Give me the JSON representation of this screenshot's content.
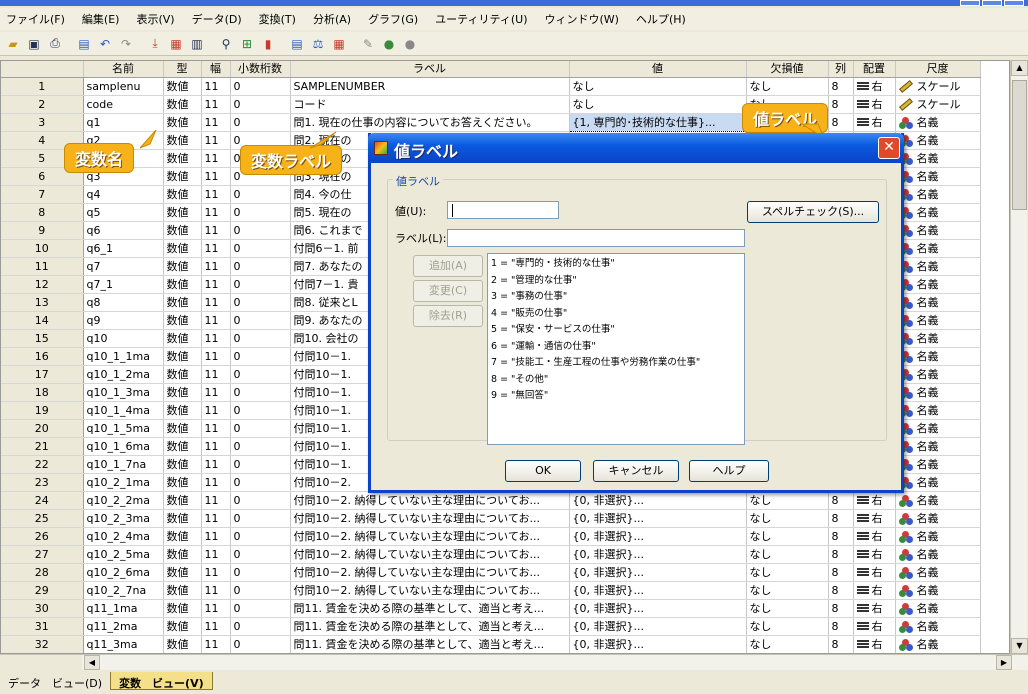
{
  "menubar": [
    "ファイル(F)",
    "編集(E)",
    "表示(V)",
    "データ(D)",
    "変換(T)",
    "分析(A)",
    "グラフ(G)",
    "ユーティリティ(U)",
    "ウィンドウ(W)",
    "ヘルプ(H)"
  ],
  "columns": [
    "",
    "名前",
    "型",
    "幅",
    "小数桁数",
    "ラベル",
    "値",
    "欠損値",
    "列",
    "配置",
    "尺度"
  ],
  "rows": [
    {
      "n": "1",
      "name": "samplenu",
      "type": "数値",
      "width": "11",
      "dec": "0",
      "label": "SAMPLENUMBER",
      "values": "なし",
      "missing": "なし",
      "cols": "8",
      "align": "右",
      "measure": "スケール"
    },
    {
      "n": "2",
      "name": "code",
      "type": "数値",
      "width": "11",
      "dec": "0",
      "label": "コード",
      "values": "なし",
      "missing": "なし",
      "cols": "8",
      "align": "右",
      "measure": "スケール"
    },
    {
      "n": "3",
      "name": "q1",
      "type": "数値",
      "width": "11",
      "dec": "0",
      "label": "問1. 現在の仕事の内容についてお答えください。",
      "values": "{1, 専門的･技術的な仕事}...",
      "missing": "なし",
      "cols": "8",
      "align": "右",
      "measure": "名義"
    },
    {
      "n": "4",
      "name": "q2",
      "type": "数値",
      "width": "11",
      "dec": "0",
      "label": "問2. 現在の",
      "values": "",
      "missing": "",
      "cols": "",
      "align": "",
      "measure": "名義"
    },
    {
      "n": "5",
      "name": "q3",
      "type": "数値",
      "width": "11",
      "dec": "0",
      "label": "問3. 現在の",
      "values": "",
      "missing": "",
      "cols": "",
      "align": "",
      "measure": "名義"
    },
    {
      "n": "6",
      "name": "q3",
      "type": "数値",
      "width": "11",
      "dec": "0",
      "label": "問3. 現在の",
      "values": "",
      "missing": "",
      "cols": "",
      "align": "",
      "measure": "名義"
    },
    {
      "n": "7",
      "name": "q4",
      "type": "数値",
      "width": "11",
      "dec": "0",
      "label": "問4. 今の仕",
      "values": "",
      "missing": "",
      "cols": "",
      "align": "",
      "measure": "名義"
    },
    {
      "n": "8",
      "name": "q5",
      "type": "数値",
      "width": "11",
      "dec": "0",
      "label": "問5. 現在の",
      "values": "",
      "missing": "",
      "cols": "",
      "align": "",
      "measure": "名義"
    },
    {
      "n": "9",
      "name": "q6",
      "type": "数値",
      "width": "11",
      "dec": "0",
      "label": "問6. これまで",
      "values": "",
      "missing": "",
      "cols": "",
      "align": "",
      "measure": "名義"
    },
    {
      "n": "10",
      "name": "q6_1",
      "type": "数値",
      "width": "11",
      "dec": "0",
      "label": "付問6－1. 前",
      "values": "",
      "missing": "",
      "cols": "",
      "align": "",
      "measure": "名義"
    },
    {
      "n": "11",
      "name": "q7",
      "type": "数値",
      "width": "11",
      "dec": "0",
      "label": "問7. あなたの",
      "values": "",
      "missing": "",
      "cols": "",
      "align": "",
      "measure": "名義"
    },
    {
      "n": "12",
      "name": "q7_1",
      "type": "数値",
      "width": "11",
      "dec": "0",
      "label": "付問7－1. 貴",
      "values": "",
      "missing": "",
      "cols": "",
      "align": "",
      "measure": "名義"
    },
    {
      "n": "13",
      "name": "q8",
      "type": "数値",
      "width": "11",
      "dec": "0",
      "label": "問8. 従来とL",
      "values": "",
      "missing": "",
      "cols": "",
      "align": "",
      "measure": "名義"
    },
    {
      "n": "14",
      "name": "q9",
      "type": "数値",
      "width": "11",
      "dec": "0",
      "label": "問9. あなたの",
      "values": "",
      "missing": "",
      "cols": "",
      "align": "",
      "measure": "名義"
    },
    {
      "n": "15",
      "name": "q10",
      "type": "数値",
      "width": "11",
      "dec": "0",
      "label": "問10. 会社の",
      "values": "",
      "missing": "",
      "cols": "",
      "align": "",
      "measure": "名義"
    },
    {
      "n": "16",
      "name": "q10_1_1ma",
      "type": "数値",
      "width": "11",
      "dec": "0",
      "label": "付問10－1.",
      "values": "",
      "missing": "",
      "cols": "",
      "align": "",
      "measure": "名義"
    },
    {
      "n": "17",
      "name": "q10_1_2ma",
      "type": "数値",
      "width": "11",
      "dec": "0",
      "label": "付問10－1.",
      "values": "",
      "missing": "",
      "cols": "",
      "align": "",
      "measure": "名義"
    },
    {
      "n": "18",
      "name": "q10_1_3ma",
      "type": "数値",
      "width": "11",
      "dec": "0",
      "label": "付問10－1.",
      "values": "",
      "missing": "",
      "cols": "",
      "align": "",
      "measure": "名義"
    },
    {
      "n": "19",
      "name": "q10_1_4ma",
      "type": "数値",
      "width": "11",
      "dec": "0",
      "label": "付問10－1.",
      "values": "",
      "missing": "",
      "cols": "",
      "align": "",
      "measure": "名義"
    },
    {
      "n": "20",
      "name": "q10_1_5ma",
      "type": "数値",
      "width": "11",
      "dec": "0",
      "label": "付問10－1.",
      "values": "",
      "missing": "",
      "cols": "",
      "align": "",
      "measure": "名義"
    },
    {
      "n": "21",
      "name": "q10_1_6ma",
      "type": "数値",
      "width": "11",
      "dec": "0",
      "label": "付問10－1.",
      "values": "",
      "missing": "",
      "cols": "",
      "align": "",
      "measure": "名義"
    },
    {
      "n": "22",
      "name": "q10_1_7na",
      "type": "数値",
      "width": "11",
      "dec": "0",
      "label": "付問10－1.",
      "values": "",
      "missing": "",
      "cols": "",
      "align": "",
      "measure": "名義"
    },
    {
      "n": "23",
      "name": "q10_2_1ma",
      "type": "数値",
      "width": "11",
      "dec": "0",
      "label": "付問10－2.",
      "values": "",
      "missing": "",
      "cols": "",
      "align": "",
      "measure": "名義"
    },
    {
      "n": "24",
      "name": "q10_2_2ma",
      "type": "数値",
      "width": "11",
      "dec": "0",
      "label": "付問10－2. 納得していない主な理由についてお...",
      "values": "{0, 非選択}...",
      "missing": "なし",
      "cols": "8",
      "align": "右",
      "measure": "名義"
    },
    {
      "n": "25",
      "name": "q10_2_3ma",
      "type": "数値",
      "width": "11",
      "dec": "0",
      "label": "付問10－2. 納得していない主な理由についてお...",
      "values": "{0, 非選択}...",
      "missing": "なし",
      "cols": "8",
      "align": "右",
      "measure": "名義"
    },
    {
      "n": "26",
      "name": "q10_2_4ma",
      "type": "数値",
      "width": "11",
      "dec": "0",
      "label": "付問10－2. 納得していない主な理由についてお...",
      "values": "{0, 非選択}...",
      "missing": "なし",
      "cols": "8",
      "align": "右",
      "measure": "名義"
    },
    {
      "n": "27",
      "name": "q10_2_5ma",
      "type": "数値",
      "width": "11",
      "dec": "0",
      "label": "付問10－2. 納得していない主な理由についてお...",
      "values": "{0, 非選択}...",
      "missing": "なし",
      "cols": "8",
      "align": "右",
      "measure": "名義"
    },
    {
      "n": "28",
      "name": "q10_2_6ma",
      "type": "数値",
      "width": "11",
      "dec": "0",
      "label": "付問10－2. 納得していない主な理由についてお...",
      "values": "{0, 非選択}...",
      "missing": "なし",
      "cols": "8",
      "align": "右",
      "measure": "名義"
    },
    {
      "n": "29",
      "name": "q10_2_7na",
      "type": "数値",
      "width": "11",
      "dec": "0",
      "label": "付問10－2. 納得していない主な理由についてお...",
      "values": "{0, 非選択}...",
      "missing": "なし",
      "cols": "8",
      "align": "右",
      "measure": "名義"
    },
    {
      "n": "30",
      "name": "q11_1ma",
      "type": "数値",
      "width": "11",
      "dec": "0",
      "label": "問11. 賃金を決める際の基準として、適当と考え...",
      "values": "{0, 非選択}...",
      "missing": "なし",
      "cols": "8",
      "align": "右",
      "measure": "名義"
    },
    {
      "n": "31",
      "name": "q11_2ma",
      "type": "数値",
      "width": "11",
      "dec": "0",
      "label": "問11. 賃金を決める際の基準として、適当と考え...",
      "values": "{0, 非選択}...",
      "missing": "なし",
      "cols": "8",
      "align": "右",
      "measure": "名義"
    },
    {
      "n": "32",
      "name": "q11_3ma",
      "type": "数値",
      "width": "11",
      "dec": "0",
      "label": "問11. 賃金を決める際の基準として、適当と考え...",
      "values": "{0, 非選択}...",
      "missing": "なし",
      "cols": "8",
      "align": "右",
      "measure": "名義"
    }
  ],
  "callouts": {
    "var_name": "変数名",
    "var_label": "変数ラベル",
    "value_label": "値ラベル"
  },
  "dialog": {
    "title": "値ラベル",
    "close": "✕",
    "group_label": "値ラベル",
    "value_label": "値(U):",
    "label_label": "ラベル(L):",
    "value_input": "",
    "label_input": "",
    "spell_check": "スペルチェック(S)...",
    "add": "追加(A)",
    "change": "変更(C)",
    "remove": "除去(R)",
    "list": [
      "1 = \"専門的・技術的な仕事\"",
      "2 = \"管理的な仕事\"",
      "3 = \"事務の仕事\"",
      "4 = \"販売の仕事\"",
      "5 = \"保安・サービスの仕事\"",
      "6 = \"運輸・通信の仕事\"",
      "7 = \"技能工・生産工程の仕事や労務作業の仕事\"",
      "8 = \"その他\"",
      "9 = \"無回答\""
    ],
    "ok": "OK",
    "cancel": "キャンセル",
    "help": "ヘルプ"
  },
  "tabs": {
    "data_view": "データ　ビュー(D)",
    "variable_view": "変数　ビュー(V)"
  },
  "colors": {
    "callout": "#f7b21a",
    "dialog_title": "#0a43c8",
    "active_tab": "#f5e08a"
  }
}
